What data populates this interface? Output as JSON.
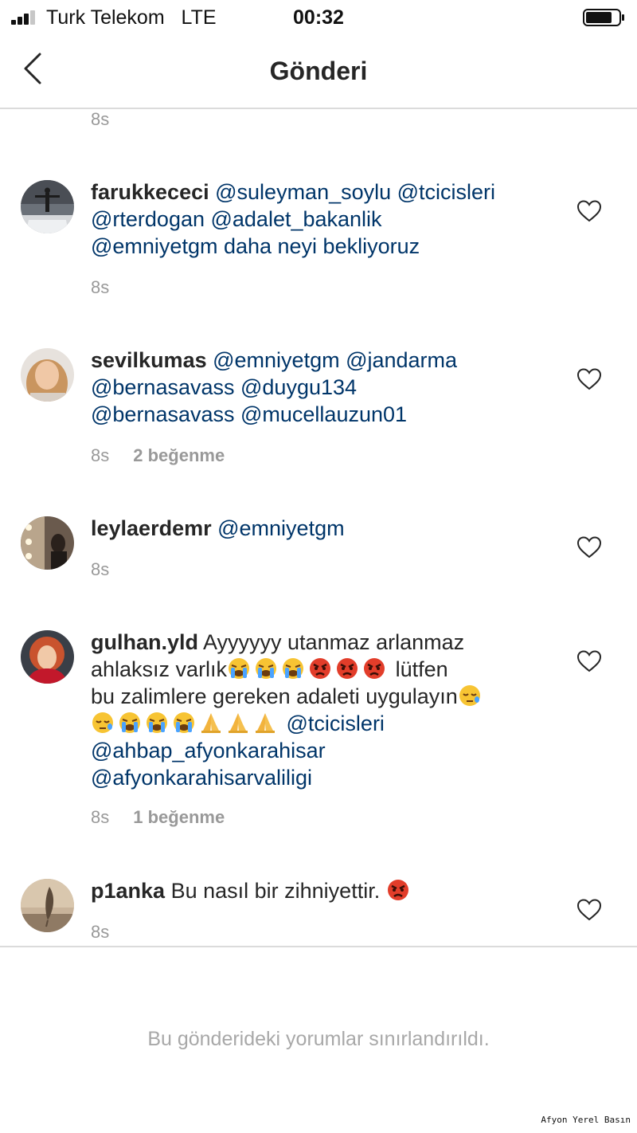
{
  "status_bar": {
    "carrier": "Turk Telekom",
    "network": "LTE",
    "time": "00:32"
  },
  "nav": {
    "title": "Gönderi"
  },
  "top_timestamp": "8s",
  "comments": [
    {
      "username": "farukkececi",
      "lines": [
        "@suleyman_soylu @tcicisleri",
        "@rterdogan @adalet_bakanlik",
        "@emniyetgm  daha neyi bekliyoruz"
      ],
      "time": "8s",
      "likes": ""
    },
    {
      "username": "sevilkumas",
      "lines": [
        "@emniyetgm @jandarma",
        "@bernasavass @duygu134",
        "@bernasavass @mucellauzun01"
      ],
      "time": "8s",
      "likes": "2 beğenme"
    },
    {
      "username": "leylaerdemr",
      "lines": [
        "@emniyetgm"
      ],
      "time": "8s",
      "likes": ""
    },
    {
      "username": "gulhan.yld",
      "segments": {
        "text1": "Ayyyyyy utanmaz arlanmaz",
        "text2": "ahlaksız varlık",
        "text3": "lütfen",
        "text4": "bu zalimlere gereken adaleti uygulayın",
        "mention1": "@tcicisleri",
        "mention2": "@ahbap_afyonkarahisar",
        "mention3": "@afyonkarahisarvaliligi"
      },
      "emojis": {
        "line2": [
          "crying-face",
          "crying-face",
          "crying-face",
          "angry-face",
          "angry-face",
          "angry-face"
        ],
        "line3": [
          "sleepy-face"
        ],
        "line4": [
          "sleepy-face",
          "crying-face",
          "crying-face",
          "crying-face",
          "folded-hands",
          "folded-hands",
          "folded-hands"
        ]
      },
      "time": "8s",
      "likes": "1 beğenme"
    },
    {
      "username": "p1anka",
      "text": "Bu nasıl bir zihniyettir.",
      "emojis": [
        "angry-face"
      ],
      "time": "8s",
      "likes": ""
    }
  ],
  "footer": {
    "restricted_text": "Bu gönderideki yorumlar sınırlandırıldı."
  },
  "watermark": "Afyon Yerel Basın",
  "colors": {
    "mention": "#003569",
    "meta": "#999999",
    "divider": "#dbdbdb",
    "text": "#262626"
  }
}
